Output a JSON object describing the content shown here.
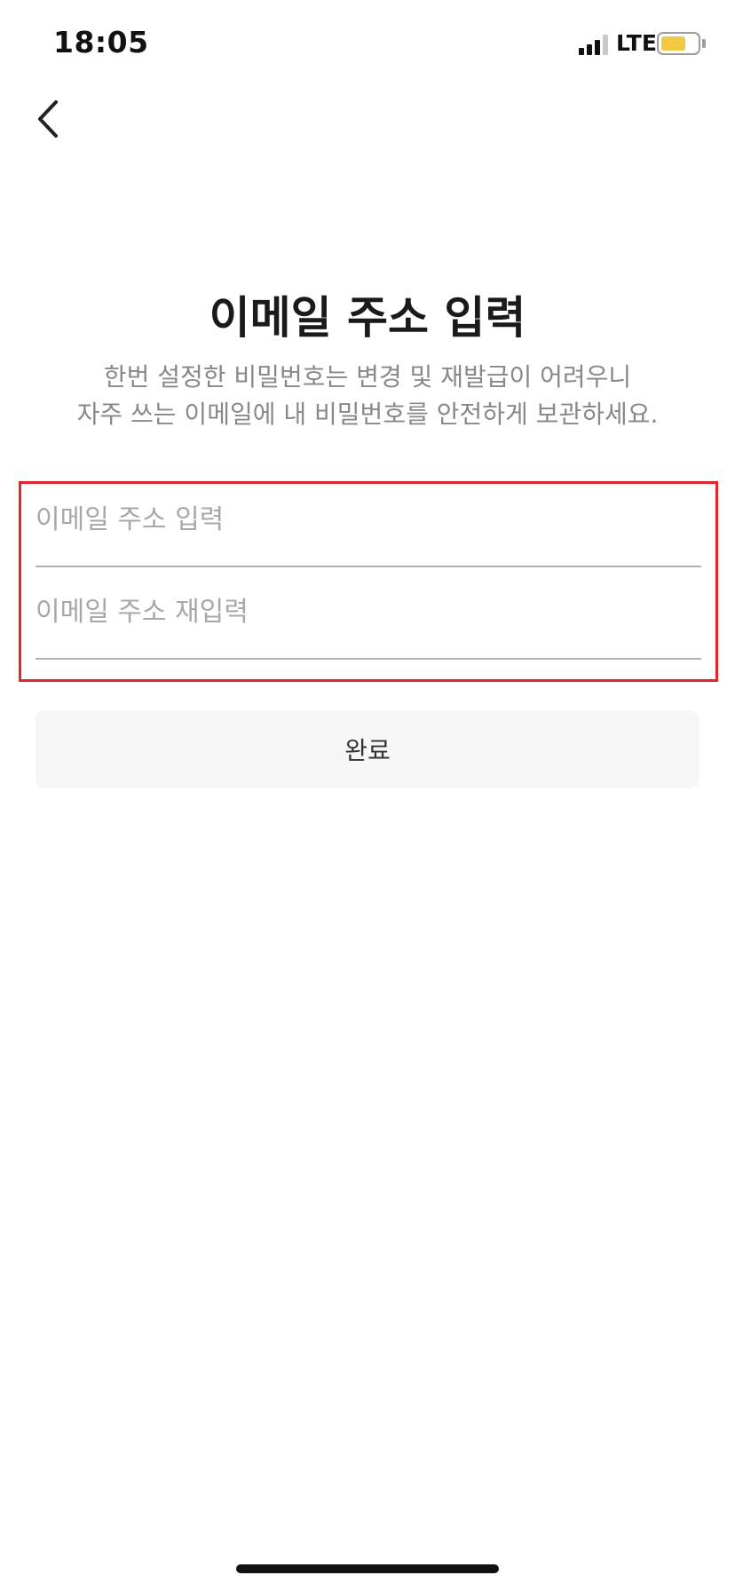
{
  "status_bar": {
    "time": "18:05",
    "network": "LTE",
    "colors": {
      "battery_fill": "#f3c843"
    }
  },
  "nav": {
    "back_icon": "chevron-left-icon"
  },
  "header": {
    "title": "이메일 주소 입력",
    "subtitle_line1": "한번 설정한 비밀번호는 변경 및 재발급이 어려우니",
    "subtitle_line2": "자주 쓰는 이메일에 내 비밀번호를 안전하게 보관하세요."
  },
  "form": {
    "email_field": {
      "value": "",
      "placeholder": "이메일 주소 입력"
    },
    "email_confirm_field": {
      "value": "",
      "placeholder": "이메일 주소 재입력"
    },
    "highlight_color": "#e3242b"
  },
  "actions": {
    "complete_label": "완료"
  }
}
